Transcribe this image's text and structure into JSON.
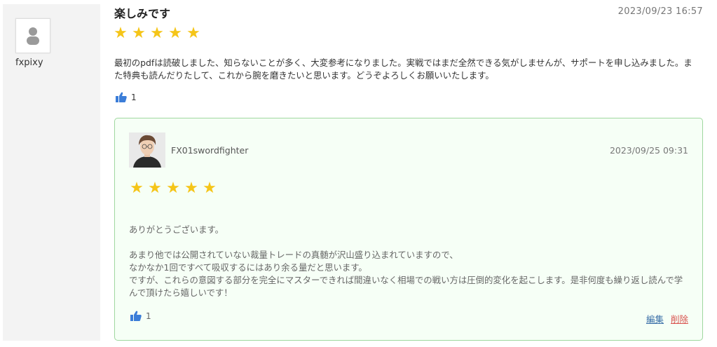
{
  "review": {
    "username": "fxpixy",
    "title": "楽しみです",
    "date": "2023/09/23 16:57",
    "rating": 5,
    "body": "最初のpdfは読破しました、知らないことが多く、大変参考になりました。実戦ではまだ全然できる気がしませんが、サポートを申し込みました。また特典も読んだりたして、これから腕を磨きたいと思います。どうぞよろしくお願いいたします。",
    "like_count": "1",
    "like_icon": "thumbs-up-icon"
  },
  "reply": {
    "author": "FX01swordfighter",
    "date": "2023/09/25 09:31",
    "rating": 5,
    "line1": "ありがとうございます。",
    "line2": "あまり他では公開されていない裁量トレードの真髄が沢山盛り込まれていますので、",
    "line3": "なかなか1回ですべて吸収するにはあり余る量だと思います。",
    "line4": "ですが、これらの意図する部分を完全にマスターできれば間違いなく相場での戦い方は圧倒的変化を起こします。是非何度も繰り返し読んで学んで頂けたら嬉しいです！",
    "like_count": "1",
    "edit_label": "編集",
    "delete_label": "削除"
  },
  "colors": {
    "star": "#f5c518",
    "thumb": "#3b7dd8",
    "reply_border": "#9fd79f",
    "reply_bg": "#f6fff6",
    "edit_link": "#3a6fa8",
    "delete_link": "#d9534f"
  }
}
